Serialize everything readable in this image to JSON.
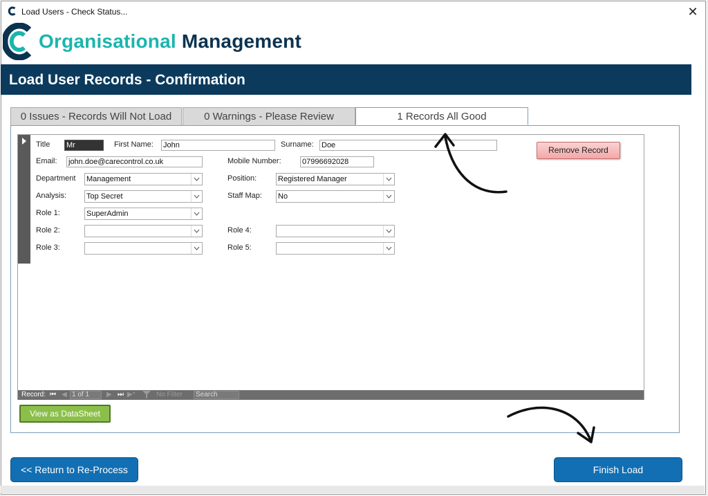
{
  "window": {
    "title": "Load Users - Check Status...",
    "close_glyph": "✕"
  },
  "logo": {
    "text_part1": "Organisational",
    "text_part2": " Management",
    "icon": "c-logo-icon"
  },
  "banner": {
    "title": "Load User Records - Confirmation"
  },
  "tabs": [
    {
      "label": "0 Issues - Records Will Not Load",
      "active": false
    },
    {
      "label": "0 Warnings - Please Review",
      "active": false
    },
    {
      "label": "1 Records All Good",
      "active": true
    }
  ],
  "form": {
    "title_label": "Title",
    "title_value": "Mr",
    "first_name_label": "First Name:",
    "first_name_value": "John",
    "surname_label": "Surname:",
    "surname_value": "Doe",
    "email_label": "Email:",
    "email_value": "john.doe@carecontrol.co.uk",
    "mobile_label": "Mobile Number:",
    "mobile_value": "07996692028",
    "department_label": "Department",
    "department_value": "Management",
    "position_label": "Position:",
    "position_value": "Registered Manager",
    "analysis_label": "Analysis:",
    "analysis_value": "Top Secret",
    "staff_map_label": "Staff Map:",
    "staff_map_value": "No",
    "role1_label": "Role 1:",
    "role1_value": "SuperAdmin",
    "role2_label": "Role 2:",
    "role2_value": "",
    "role3_label": "Role 3:",
    "role3_value": "",
    "role4_label": "Role 4:",
    "role4_value": "",
    "role5_label": "Role 5:",
    "role5_value": ""
  },
  "buttons": {
    "remove_record": "Remove Record",
    "view_datasheet": "View as DataSheet",
    "return": "<< Return to Re-Process",
    "finish": "Finish Load"
  },
  "navigation": {
    "record_label": "Record:",
    "first": "⏮",
    "prev": "◀",
    "current": "1 of 1",
    "next": "▶",
    "last": "⏭",
    "new": "▶*",
    "filter_icon": "filter-icon",
    "filter": "No Filter",
    "search": "Search"
  },
  "colors": {
    "banner": "#0b3a5c",
    "logo_teal": "#1bb5ad",
    "logo_navy": "#0b3350",
    "primary_button": "#136fb3",
    "remove_button": "#f3a7a7",
    "datasheet_button": "#8cbf4a"
  }
}
